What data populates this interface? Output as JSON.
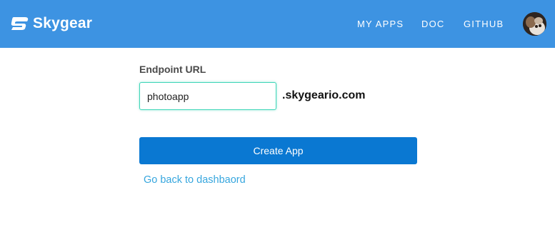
{
  "header": {
    "brand": "Skygear",
    "logo_icon": "skygear-logo-icon",
    "background_color": "#3d93e2",
    "nav": {
      "my_apps": "MY APPS",
      "doc": "DOC",
      "github": "GITHUB"
    },
    "avatar_icon": "user-avatar"
  },
  "form": {
    "endpoint_label": "Endpoint URL",
    "endpoint_value": "photoapp",
    "domain_suffix": ".skygeario.com",
    "submit_label": "Create App",
    "submit_color": "#0a78d2",
    "back_link": "Go back to dashbaord"
  }
}
